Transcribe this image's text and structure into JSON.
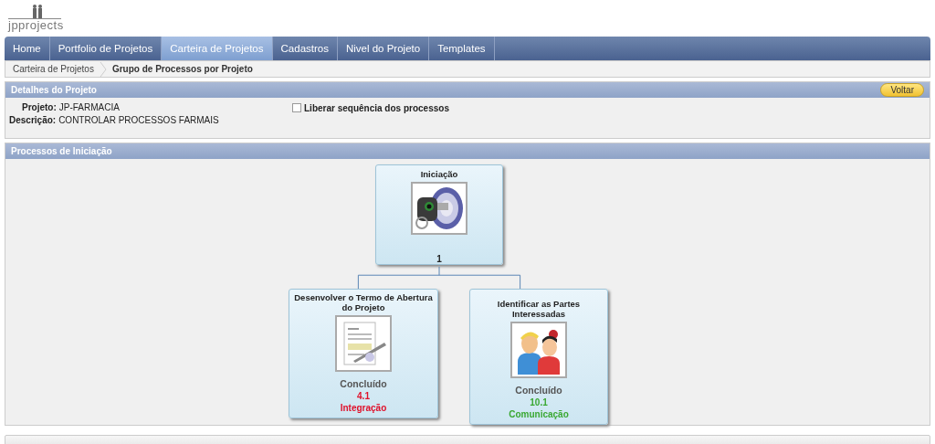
{
  "logo": {
    "text": "jpprojects"
  },
  "nav": [
    {
      "label": "Home",
      "selected": false
    },
    {
      "label": "Portfolio de Projetos",
      "selected": false
    },
    {
      "label": "Carteira de Projetos",
      "selected": true
    },
    {
      "label": "Cadastros",
      "selected": false
    },
    {
      "label": "Nivel do Projeto",
      "selected": false
    },
    {
      "label": "Templates",
      "selected": false
    }
  ],
  "breadcrumb": [
    "Carteira de Projetos",
    "Grupo de Processos por Projeto"
  ],
  "details": {
    "title": "Detalhes do Projeto",
    "back_button": "Voltar",
    "fields": [
      {
        "label": "Projeto:",
        "value": "JP-FARMACIA"
      },
      {
        "label": "Descrição:",
        "value": "CONTROLAR PROCESSOS FARMAIS"
      }
    ],
    "checkbox": {
      "label": "Liberar sequência dos processos",
      "checked": false
    }
  },
  "processes": {
    "title": "Processos de Iniciação",
    "root": {
      "title": "Iniciação",
      "number": "1"
    },
    "children": [
      {
        "title": "Desenvolver o Termo de Abertura do Projeto",
        "status": "Concluído",
        "code": "4.1",
        "area": "Integração",
        "color": "#e0112b"
      },
      {
        "title": "Identificar as Partes Interessadas",
        "status": "Concluído",
        "code": "10.1",
        "area": "Comunicação",
        "color": "#3aa832"
      }
    ]
  }
}
